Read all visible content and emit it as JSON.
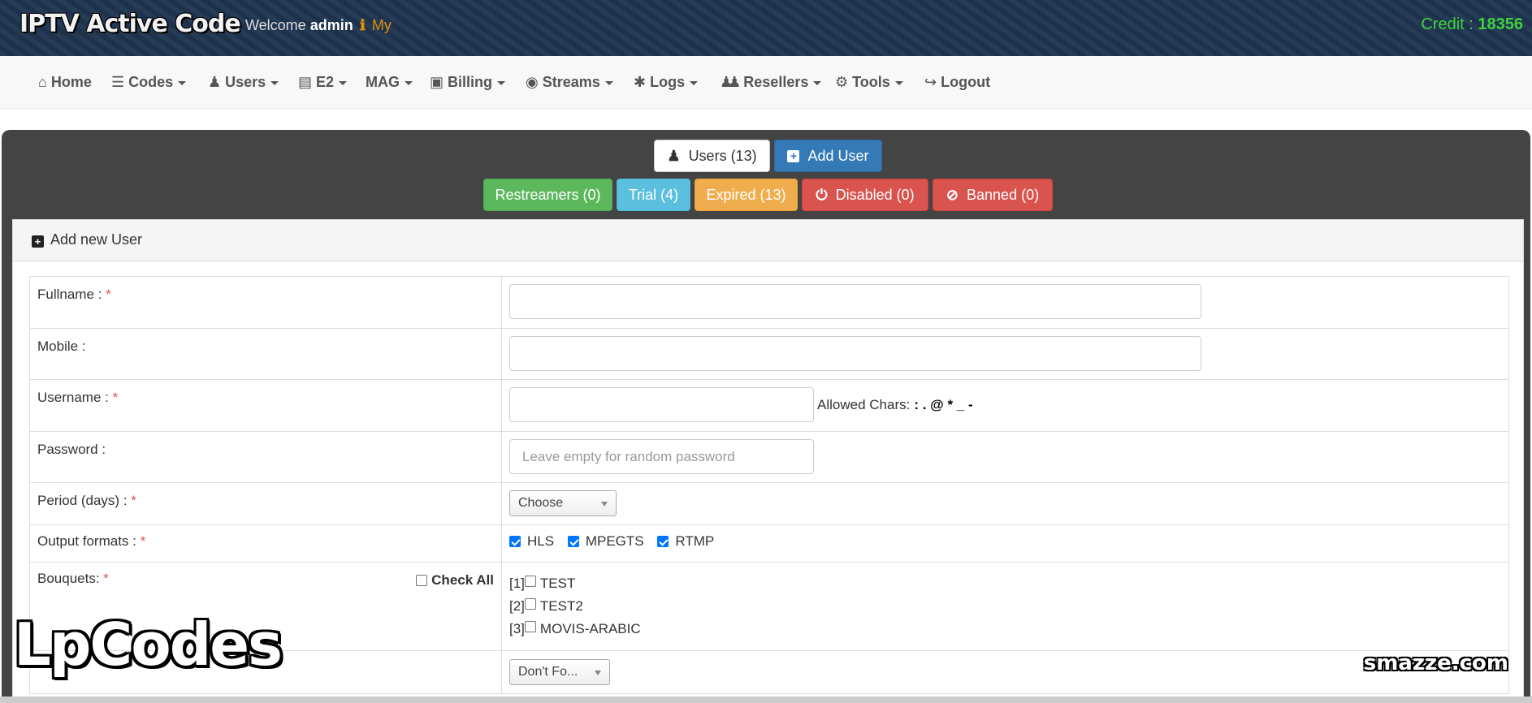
{
  "header": {
    "brand": "IPTV Active Code",
    "welcome_prefix": "Welcome",
    "username": "admin",
    "my_icon": "ℹ",
    "my_label": "My",
    "credit_label": "Credit :",
    "credit_value": "18356"
  },
  "nav": [
    {
      "label": "Home",
      "icon": "home-icon",
      "glyph": "⌂",
      "caret": false
    },
    {
      "label": "Codes",
      "icon": "list-icon",
      "glyph": "☰",
      "caret": true
    },
    {
      "label": "Users",
      "icon": "user-icon",
      "glyph": "♟",
      "caret": true
    },
    {
      "label": "E2",
      "icon": "server-icon",
      "glyph": "▤",
      "caret": true
    },
    {
      "label": "MAG",
      "icon": "",
      "glyph": "",
      "caret": true
    },
    {
      "label": "Billing",
      "icon": "money-icon",
      "glyph": "▣",
      "caret": true
    },
    {
      "label": "Streams",
      "icon": "podcast-icon",
      "glyph": "◉",
      "caret": true
    },
    {
      "label": "Logs",
      "icon": "bug-icon",
      "glyph": "✱",
      "caret": true
    },
    {
      "label": "Resellers",
      "icon": "users-icon",
      "glyph": "♟♟",
      "caret": true
    },
    {
      "label": "Tools",
      "icon": "gear-icon",
      "glyph": "⚙",
      "caret": true
    },
    {
      "label": "Logout",
      "icon": "sign-out-icon",
      "glyph": "↪",
      "caret": false
    }
  ],
  "actions": {
    "users_tab": "Users (13)",
    "add_user": "Add User",
    "restreamers": "Restreamers (0)",
    "trial": "Trial (4)",
    "expired": "Expired (13)",
    "disabled": "Disabled (0)",
    "banned": "Banned (0)"
  },
  "panel": {
    "title": "Add new User"
  },
  "form": {
    "fullname_label": "Fullname :",
    "fullname_value": "",
    "mobile_label": "Mobile :",
    "mobile_value": "",
    "username_label": "Username :",
    "username_value": "",
    "allowed_chars_label": "Allowed Chars:",
    "allowed_chars": ": . @ * _ -",
    "password_label": "Password :",
    "password_placeholder": "Leave empty for random password",
    "period_label": "Period (days) :",
    "period_value": "Choose",
    "output_label": "Output formats :",
    "output_formats": [
      {
        "label": "HLS",
        "checked": true
      },
      {
        "label": "MPEGTS",
        "checked": true
      },
      {
        "label": "RTMP",
        "checked": true
      }
    ],
    "bouquets_label": "Bouquets:",
    "check_all_label": "Check All",
    "bouquets": [
      {
        "index": "[1]",
        "label": "TEST",
        "checked": false
      },
      {
        "index": "[2]",
        "label": "TEST2",
        "checked": false
      },
      {
        "index": "[3]",
        "label": "MOVIS-ARABIC",
        "checked": false
      }
    ],
    "next_select_value": "Don't Fo..."
  },
  "watermarks": {
    "left": "LpCodes",
    "right": "smazze.com"
  },
  "colors": {
    "topbar": "#1f3550",
    "credit": "#3ed23e",
    "primary": "#337ab7",
    "success": "#5cb85c",
    "info": "#5bc0de",
    "warning": "#f0ad4e",
    "danger": "#d9534f"
  }
}
